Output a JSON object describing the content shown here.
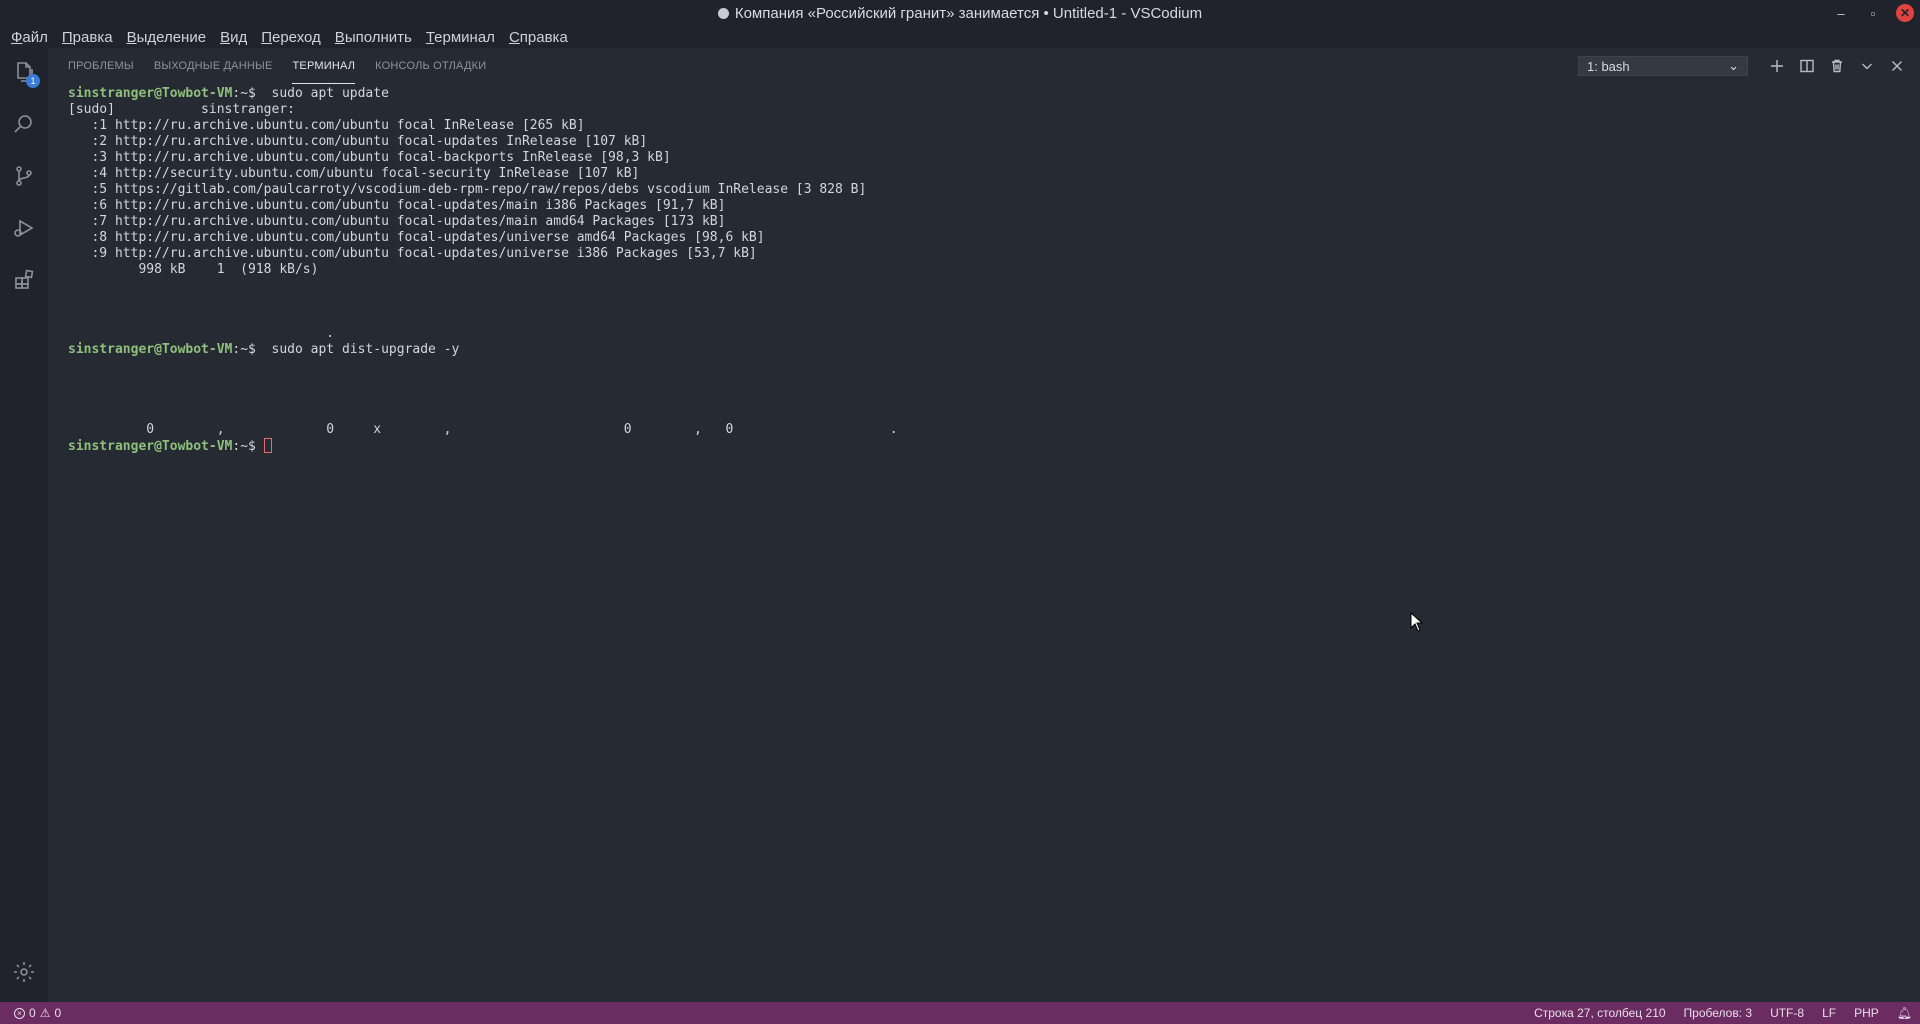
{
  "window": {
    "title": "Компания «Российский гранит» занимается • Untitled-1 - VSCodium",
    "minimize": "–",
    "restore": "▫",
    "close": "✕"
  },
  "menu": [
    "Файл",
    "Правка",
    "Выделение",
    "Вид",
    "Переход",
    "Выполнить",
    "Терминал",
    "Справка"
  ],
  "activity": {
    "explorer_badge": "1"
  },
  "panel": {
    "tabs": [
      "ПРОБЛЕМЫ",
      "ВЫХОДНЫЕ ДАННЫЕ",
      "ТЕРМИНАЛ",
      "КОНСОЛЬ ОТЛАДКИ"
    ],
    "active_tab": "ТЕРМИНАЛ",
    "terminal_select": "1: bash",
    "select_chevron": "⌄"
  },
  "terminal": {
    "prompt_user": "sinstranger@Towbot-VM",
    "prompt_sep": ":~$",
    "lines": [
      {
        "prompt": true,
        "cmd": "  sudo apt update"
      },
      {
        "text": "[sudo]           sinstranger:"
      },
      {
        "text": "   :1 http://ru.archive.ubuntu.com/ubuntu focal InRelease [265 kB]"
      },
      {
        "text": "   :2 http://ru.archive.ubuntu.com/ubuntu focal-updates InRelease [107 kB]"
      },
      {
        "text": "   :3 http://ru.archive.ubuntu.com/ubuntu focal-backports InRelease [98,3 kB]"
      },
      {
        "text": "   :4 http://security.ubuntu.com/ubuntu focal-security InRelease [107 kB]"
      },
      {
        "text": "   :5 https://gitlab.com/paulcarroty/vscodium-deb-rpm-repo/raw/repos/debs vscodium InRelease [3 828 B]"
      },
      {
        "text": "   :6 http://ru.archive.ubuntu.com/ubuntu focal-updates/main i386 Packages [91,7 kB]"
      },
      {
        "text": "   :7 http://ru.archive.ubuntu.com/ubuntu focal-updates/main amd64 Packages [173 kB]"
      },
      {
        "text": "   :8 http://ru.archive.ubuntu.com/ubuntu focal-updates/universe amd64 Packages [98,6 kB]"
      },
      {
        "text": "   :9 http://ru.archive.ubuntu.com/ubuntu focal-updates/universe i386 Packages [53,7 kB]"
      },
      {
        "text": "         998 kB    1  (918 kB/s)"
      },
      {
        "text": ""
      },
      {
        "text": ""
      },
      {
        "text": ""
      },
      {
        "text": "                                 ."
      },
      {
        "prompt": true,
        "cmd": "  sudo apt dist-upgrade -y"
      },
      {
        "text": ""
      },
      {
        "text": ""
      },
      {
        "text": ""
      },
      {
        "text": ""
      },
      {
        "text": "          0        ,             0     x        ,                      0        ,   0                    ."
      },
      {
        "prompt": true,
        "cmd": " ",
        "cursor": true
      }
    ]
  },
  "status": {
    "errors": "0",
    "warnings": "0",
    "position": "Строка 27, столбец 210",
    "spaces": "Пробелов: 3",
    "encoding": "UTF-8",
    "eol": "LF",
    "language": "PHP"
  }
}
